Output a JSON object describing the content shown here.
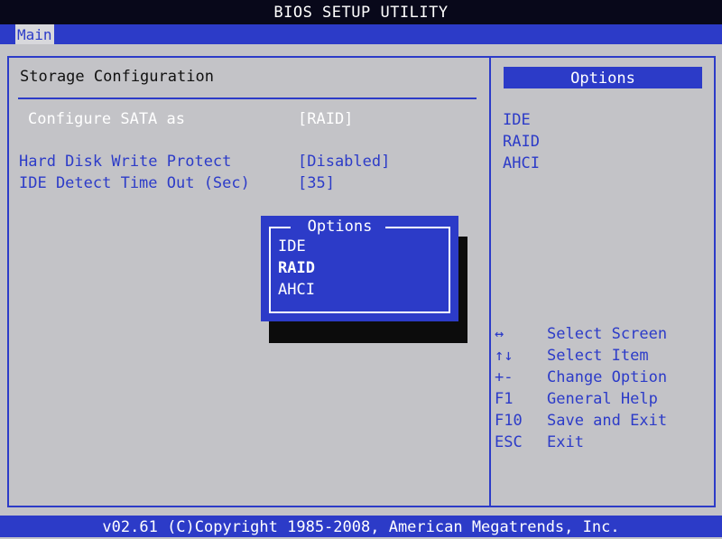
{
  "titlebar": {
    "title": "BIOS SETUP UTILITY"
  },
  "menubar": {
    "tabs": [
      {
        "label": "Main",
        "selected": true
      }
    ]
  },
  "main": {
    "section_title": "Storage Configuration",
    "settings": [
      {
        "label": "Configure SATA as",
        "value": "[RAID]",
        "highlighted": true
      },
      {
        "label": "Hard Disk Write Protect",
        "value": "[Disabled]"
      },
      {
        "label": "IDE Detect Time Out (Sec)",
        "value": "[35]"
      }
    ]
  },
  "side_panel": {
    "header": "Options",
    "options": [
      "IDE",
      "RAID",
      "AHCI"
    ],
    "help": [
      {
        "key": "↔",
        "action": "Select Screen",
        "icon": "left-right-arrows-icon"
      },
      {
        "key": "↑↓",
        "action": "Select Item",
        "icon": "up-down-arrows-icon"
      },
      {
        "key": "+-",
        "action": "Change Option"
      },
      {
        "key": "F1",
        "action": "General Help"
      },
      {
        "key": "F10",
        "action": "Save and Exit"
      },
      {
        "key": "ESC",
        "action": "Exit"
      }
    ]
  },
  "popup": {
    "title": "Options",
    "options": [
      "IDE",
      "RAID",
      "AHCI"
    ],
    "selected": "RAID"
  },
  "footer": {
    "text": "v02.61 (C)Copyright 1985-2008, American Megatrends, Inc."
  },
  "colors": {
    "bios_blue": "#2c3bc8",
    "background": "#c3c3c7",
    "title_bar": "#08081a"
  }
}
